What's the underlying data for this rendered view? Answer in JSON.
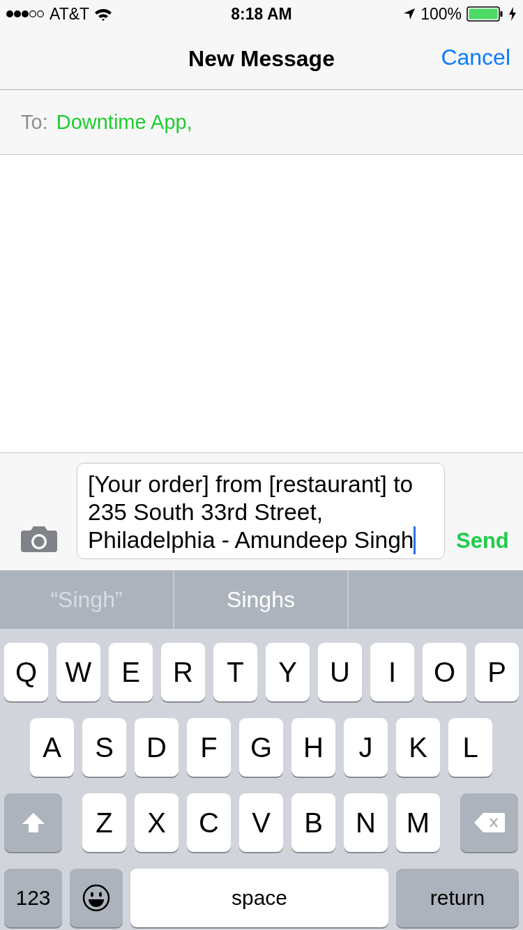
{
  "status_bar": {
    "carrier": "AT&T",
    "time": "8:18 AM",
    "battery": "100%"
  },
  "nav_bar": {
    "title": "New Message",
    "cancel": "Cancel"
  },
  "to_field": {
    "label": "To:",
    "recipient": "Downtime App,"
  },
  "compose": {
    "value": "[Your order] from [restaurant] to 235 South 33rd Street, Philadelphia - Amundeep Singh",
    "send": "Send"
  },
  "suggestions": [
    {
      "text": "“Singh”",
      "kind": "typed"
    },
    {
      "text": "Singhs",
      "kind": "word"
    }
  ],
  "keyboard": {
    "top_row": [
      "Q",
      "W",
      "E",
      "R",
      "T",
      "Y",
      "U",
      "I",
      "O",
      "P"
    ],
    "middle_row": [
      "A",
      "S",
      "D",
      "F",
      "G",
      "H",
      "J",
      "K",
      "L"
    ],
    "bottom_row": [
      "Z",
      "X",
      "C",
      "V",
      "B",
      "N",
      "M"
    ],
    "numbers_key": "123",
    "space_key": "space",
    "return_key": "return"
  }
}
